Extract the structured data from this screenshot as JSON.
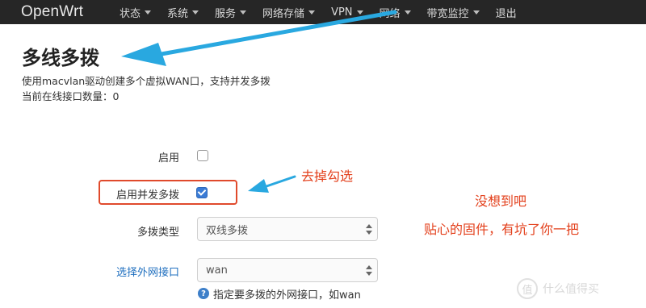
{
  "navbar": {
    "brand": "OpenWrt",
    "items": [
      {
        "label": "状态",
        "dropdown": true
      },
      {
        "label": "系统",
        "dropdown": true
      },
      {
        "label": "服务",
        "dropdown": true
      },
      {
        "label": "网络存储",
        "dropdown": true
      },
      {
        "label": "VPN",
        "dropdown": true
      },
      {
        "label": "网络",
        "dropdown": true
      },
      {
        "label": "带宽监控",
        "dropdown": true
      },
      {
        "label": "退出",
        "dropdown": false
      }
    ]
  },
  "page": {
    "title": "多线多拨",
    "description": "使用macvlan驱动创建多个虚拟WAN口，支持并发多拨",
    "online_count": "当前在线接口数量：0"
  },
  "form": {
    "enable": {
      "label": "启用",
      "checked": false
    },
    "concurrent": {
      "label": "启用并发多拨",
      "checked": true
    },
    "dial_type": {
      "label": "多拨类型",
      "value": "双线多拨"
    },
    "wan_iface": {
      "label": "选择外网接口",
      "value": "wan",
      "help": "指定要多拨的外网接口，如wan"
    }
  },
  "annotations": {
    "uncheck": "去掉勾选",
    "surprise": "没想到吧",
    "comment": "贴心的固件，有坑了你一把"
  },
  "watermark": {
    "logo": "值",
    "text": "什么值得买"
  },
  "colors": {
    "navbar": "#262626",
    "annotation": "#e3401c",
    "arrow": "#29a8e0",
    "link": "#1f6fbf"
  }
}
